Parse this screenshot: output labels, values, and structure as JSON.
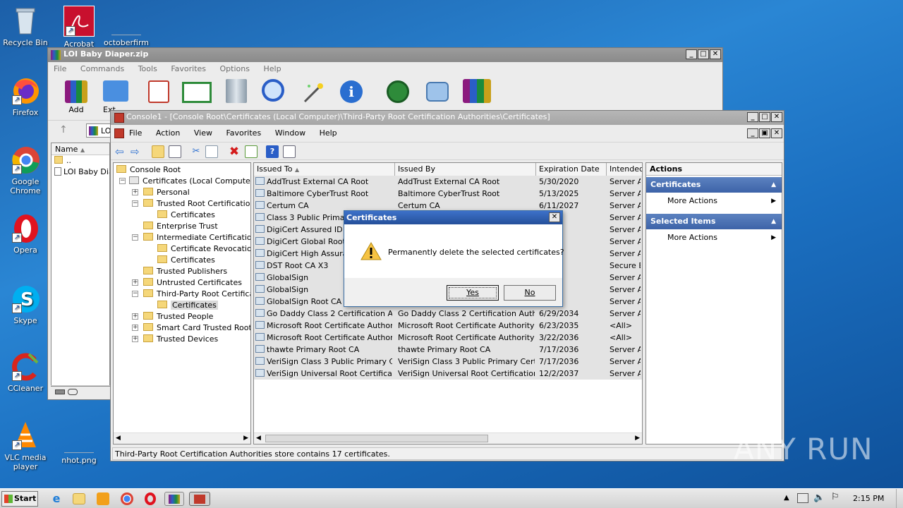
{
  "desktop": {
    "icons": [
      {
        "label": "Recycle Bin"
      },
      {
        "label": "Acrobat"
      },
      {
        "label": "octoberfirm"
      },
      {
        "label": "Firefox"
      },
      {
        "label": "Google Chrome"
      },
      {
        "label": "Opera"
      },
      {
        "label": "Skype"
      },
      {
        "label": "CCleaner"
      },
      {
        "label": "VLC media player"
      },
      {
        "label": "nhot.png"
      }
    ]
  },
  "winrar": {
    "title": "LOI Baby Diaper.zip",
    "menu": [
      "File",
      "Commands",
      "Tools",
      "Favorites",
      "Options",
      "Help"
    ],
    "toolbar": {
      "add": "Add",
      "extract": "Ext"
    },
    "path_prefix": "LO",
    "list_header": "Name",
    "rows": [
      "..",
      "LOI Baby Dia"
    ]
  },
  "mmc": {
    "title": "Console1 - [Console Root\\Certificates (Local Computer)\\Third-Party Root Certification Authorities\\Certificates]",
    "menu": [
      "File",
      "Action",
      "View",
      "Favorites",
      "Window",
      "Help"
    ],
    "tree": [
      {
        "label": "Console Root"
      },
      {
        "label": "Certificates (Local Computer)"
      },
      {
        "label": "Personal"
      },
      {
        "label": "Trusted Root Certification A"
      },
      {
        "label": "Certificates"
      },
      {
        "label": "Enterprise Trust"
      },
      {
        "label": "Intermediate Certification A"
      },
      {
        "label": "Certificate Revocation I"
      },
      {
        "label": "Certificates"
      },
      {
        "label": "Trusted Publishers"
      },
      {
        "label": "Untrusted Certificates"
      },
      {
        "label": "Third-Party Root Certificati"
      },
      {
        "label": "Certificates"
      },
      {
        "label": "Trusted People"
      },
      {
        "label": "Smart Card Trusted Roots"
      },
      {
        "label": "Trusted Devices"
      }
    ],
    "columns": [
      "Issued To",
      "Issued By",
      "Expiration Date",
      "Intended"
    ],
    "rows": [
      {
        "to": "AddTrust External CA Root",
        "by": "AddTrust External CA Root",
        "exp": "5/30/2020",
        "use": "Server Au"
      },
      {
        "to": "Baltimore CyberTrust Root",
        "by": "Baltimore CyberTrust Root",
        "exp": "5/13/2025",
        "use": "Server Au"
      },
      {
        "to": "Certum CA",
        "by": "Certum CA",
        "exp": "6/11/2027",
        "use": "Server Au"
      },
      {
        "to": "Class 3 Public Primary",
        "by": "",
        "exp": "28",
        "use": "Server Au"
      },
      {
        "to": "DigiCert Assured ID R",
        "by": "",
        "exp": "2031",
        "use": "Server Au"
      },
      {
        "to": "DigiCert Global Root C",
        "by": "",
        "exp": "2031",
        "use": "Server Au"
      },
      {
        "to": "DigiCert High Assuran",
        "by": "",
        "exp": "2031",
        "use": "Server Au"
      },
      {
        "to": "DST Root CA X3",
        "by": "",
        "exp": "021",
        "use": "Secure Er"
      },
      {
        "to": "GlobalSign",
        "by": "",
        "exp": "029",
        "use": "Server Au"
      },
      {
        "to": "GlobalSign",
        "by": "",
        "exp": "2021",
        "use": "Server Au"
      },
      {
        "to": "GlobalSign Root CA",
        "by": "",
        "exp": "028",
        "use": "Server Au"
      },
      {
        "to": "Go Daddy Class 2 Certification Au...",
        "by": "Go Daddy Class 2 Certification Auth...",
        "exp": "6/29/2034",
        "use": "Server Au"
      },
      {
        "to": "Microsoft Root Certificate Authori...",
        "by": "Microsoft Root Certificate Authority ...",
        "exp": "6/23/2035",
        "use": "<All>"
      },
      {
        "to": "Microsoft Root Certificate Authori...",
        "by": "Microsoft Root Certificate Authority ...",
        "exp": "3/22/2036",
        "use": "<All>"
      },
      {
        "to": "thawte Primary Root CA",
        "by": "thawte Primary Root CA",
        "exp": "7/17/2036",
        "use": "Server Au"
      },
      {
        "to": "VeriSign Class 3 Public Primary Cer...",
        "by": "VeriSign Class 3 Public Primary Certifi...",
        "exp": "7/17/2036",
        "use": "Server Au"
      },
      {
        "to": "VeriSign Universal Root Certificati...",
        "by": "VeriSign Universal Root Certification ...",
        "exp": "12/2/2037",
        "use": "Server Au"
      }
    ],
    "actions": {
      "title": "Actions",
      "section1": "Certificates",
      "more1": "More Actions",
      "section2": "Selected Items",
      "more2": "More Actions"
    },
    "status": "Third-Party Root Certification Authorities store contains 17 certificates."
  },
  "dialog": {
    "title": "Certificates",
    "message": "Permanently delete the selected certificates?",
    "yes": "Yes",
    "no": "No"
  },
  "taskbar": {
    "start": "Start",
    "clock": "2:15 PM"
  },
  "watermark": "ANY RUN"
}
